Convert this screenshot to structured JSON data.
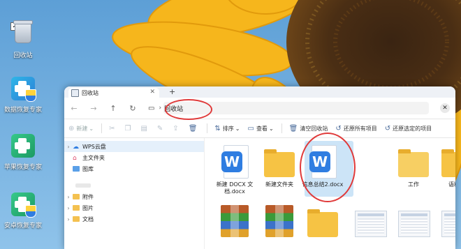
{
  "desktop": {
    "icons": [
      {
        "label": "回收站"
      },
      {
        "label": "数据恢复专家"
      },
      {
        "label": "苹果恢复专家"
      },
      {
        "label": "安卓恢复专家"
      }
    ]
  },
  "window": {
    "tab_title": "回收站",
    "tab_close": "✕",
    "new_tab": "+",
    "nav": {
      "back": "←",
      "forward": "→",
      "up": "↑",
      "refresh": "↻"
    },
    "address": {
      "pc_icon": "▭",
      "separator": "›",
      "path": "回收站"
    },
    "close": "✕",
    "toolbar": {
      "new": "新建",
      "cut_icon": "scissors-icon",
      "sort": "排序",
      "view": "查看",
      "empty_bin": "清空回收站",
      "restore_all": "还原所有项目",
      "restore_selected": "还原选定的项目"
    },
    "sidebar": [
      {
        "label": "WPS云盘",
        "caret": "›"
      },
      {
        "label": "主文件夹",
        "caret": ""
      },
      {
        "label": "图库",
        "caret": ""
      },
      {
        "label": "附件",
        "caret": "›"
      },
      {
        "label": "图片",
        "caret": "›"
      },
      {
        "label": "文档",
        "caret": "›"
      }
    ],
    "files": [
      {
        "name": "新建 DOCX 文档.docx",
        "line1": "新建 DOCX 文",
        "line2": "档.docx",
        "kind": "doc"
      },
      {
        "name": "新建文件夹",
        "line1": "新建文件夹",
        "line2": "",
        "kind": "folder"
      },
      {
        "name": "信息总结2.docx",
        "line1": "信息总结2.docx",
        "line2": "",
        "kind": "doc"
      },
      {
        "name": "",
        "line1": "",
        "line2": "",
        "kind": "blank"
      },
      {
        "name": "工作",
        "line1": "工作",
        "line2": "",
        "kind": "folder"
      },
      {
        "name": "语料资",
        "line1": "语料资",
        "line2": "",
        "kind": "partial"
      }
    ],
    "badge_letter": "W"
  },
  "colors": {
    "accent": "#2f7de1",
    "annotation": "#e03a3a",
    "folder": "#f6c344"
  }
}
